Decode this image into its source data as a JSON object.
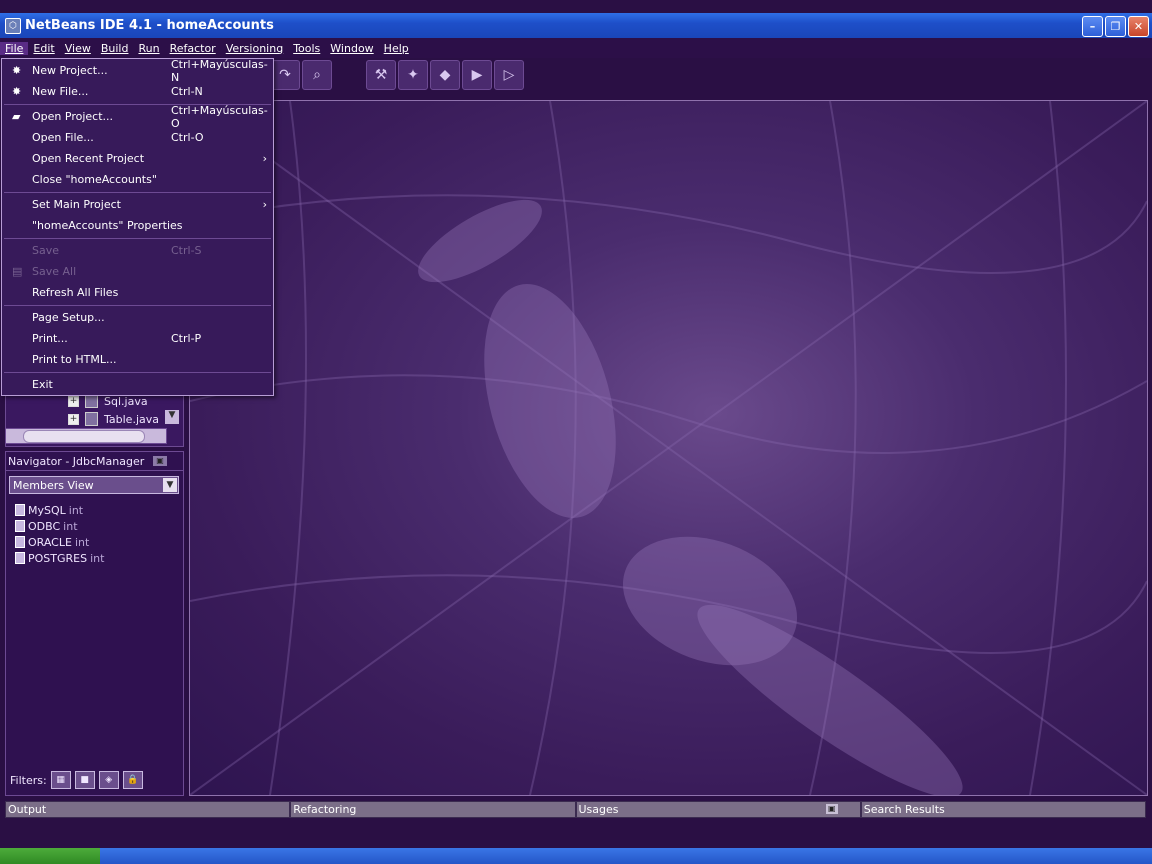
{
  "window": {
    "title": "NetBeans IDE 4.1 - homeAccounts",
    "minimize": "–",
    "restore": "❐",
    "close": "✕"
  },
  "menubar": [
    {
      "label": "File"
    },
    {
      "label": "Edit"
    },
    {
      "label": "View"
    },
    {
      "label": "Build"
    },
    {
      "label": "Run"
    },
    {
      "label": "Refactor"
    },
    {
      "label": "Versioning"
    },
    {
      "label": "Tools"
    },
    {
      "label": "Window"
    },
    {
      "label": "Help"
    }
  ],
  "file_menu": [
    {
      "label": "New Project...",
      "shortcut": "Ctrl+Mayúsculas-N",
      "enabled": true
    },
    {
      "label": "New File...",
      "shortcut": "Ctrl-N",
      "enabled": true
    },
    {
      "label": "Open Project...",
      "shortcut": "Ctrl+Mayúsculas-O",
      "enabled": true
    },
    {
      "label": "Open File...",
      "shortcut": "Ctrl-O",
      "enabled": true
    },
    {
      "label": "Open Recent Project",
      "shortcut": "",
      "enabled": true,
      "submenu": true
    },
    {
      "label": "Close \"homeAccounts\"",
      "shortcut": "",
      "enabled": true
    },
    {
      "label": "Set Main Project",
      "shortcut": "",
      "enabled": true,
      "submenu": true
    },
    {
      "label": "\"homeAccounts\" Properties",
      "shortcut": "",
      "enabled": true
    },
    {
      "label": "Save",
      "shortcut": "Ctrl-S",
      "enabled": false
    },
    {
      "label": "Save All",
      "shortcut": "",
      "enabled": false
    },
    {
      "label": "Refresh All Files",
      "shortcut": "",
      "enabled": true
    },
    {
      "label": "Page Setup...",
      "shortcut": "",
      "enabled": true
    },
    {
      "label": "Print...",
      "shortcut": "Ctrl-P",
      "enabled": true
    },
    {
      "label": "Print to HTML...",
      "shortcut": "",
      "enabled": true
    },
    {
      "label": "Exit",
      "shortcut": "",
      "enabled": true
    }
  ],
  "project_tree": [
    {
      "label": "Sql.java"
    },
    {
      "label": "Table.java"
    }
  ],
  "navigator": {
    "title": "Navigator - JdbcManager",
    "view": "Members View",
    "members": [
      {
        "name": "MySQL",
        "type": "int"
      },
      {
        "name": "ODBC",
        "type": "int"
      },
      {
        "name": "ORACLE",
        "type": "int"
      },
      {
        "name": "POSTGRES",
        "type": "int"
      }
    ],
    "filters_label": "Filters:"
  },
  "bottom_tabs": [
    {
      "label": "Output"
    },
    {
      "label": "Refactoring"
    },
    {
      "label": "Usages"
    },
    {
      "label": "Search Results"
    }
  ],
  "icons": {
    "app": "netbeans-cube-icon",
    "submenu": "›"
  }
}
